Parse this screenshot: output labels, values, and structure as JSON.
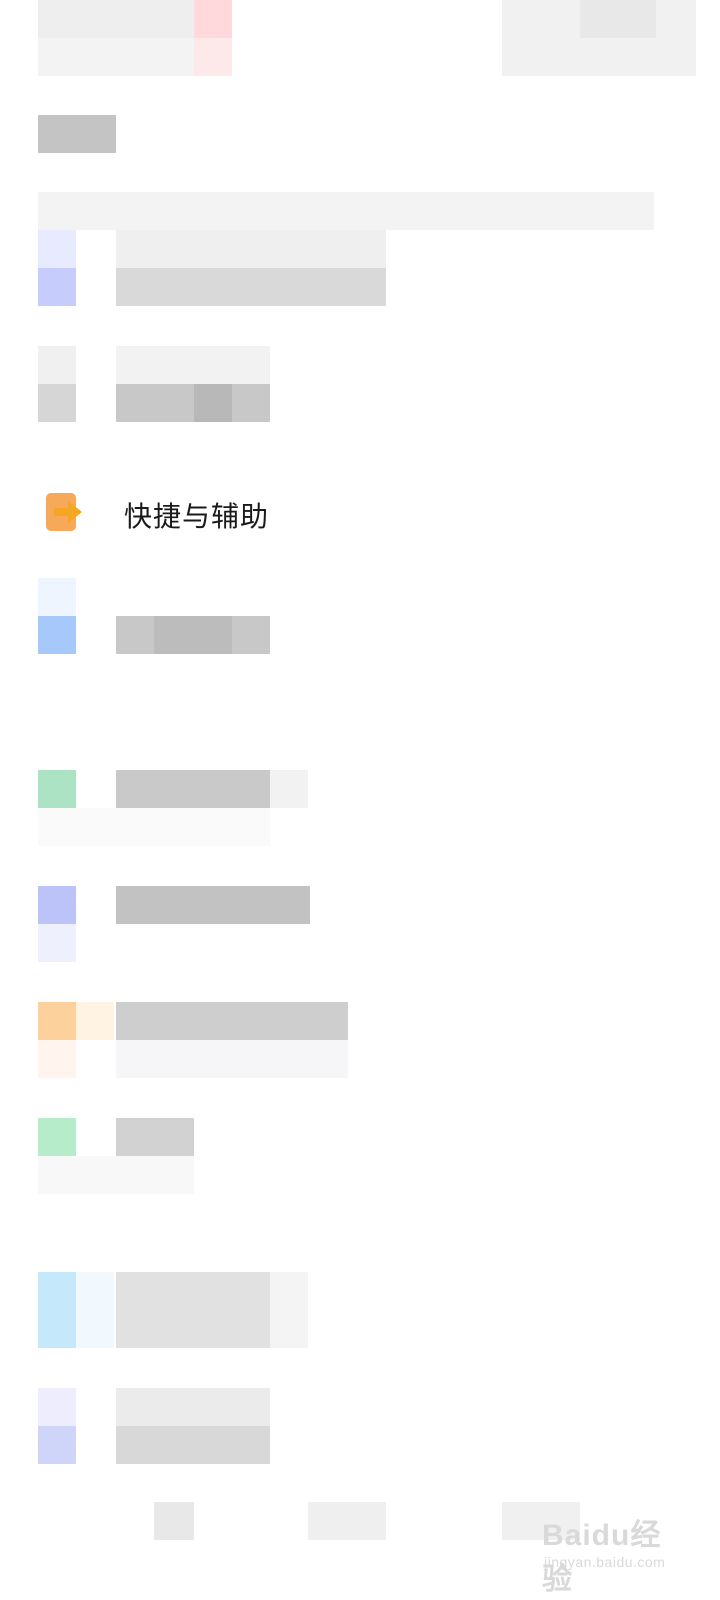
{
  "settings": {
    "shortcut_item": {
      "label": "快捷与辅助",
      "icon": "arrow-right-folder-icon"
    }
  },
  "colors": {
    "accent_orange": "#f5a623",
    "label_text": "#1a1a1a"
  },
  "watermark": {
    "brand": "Baidu经验",
    "url": "jingyan.baidu.com"
  }
}
